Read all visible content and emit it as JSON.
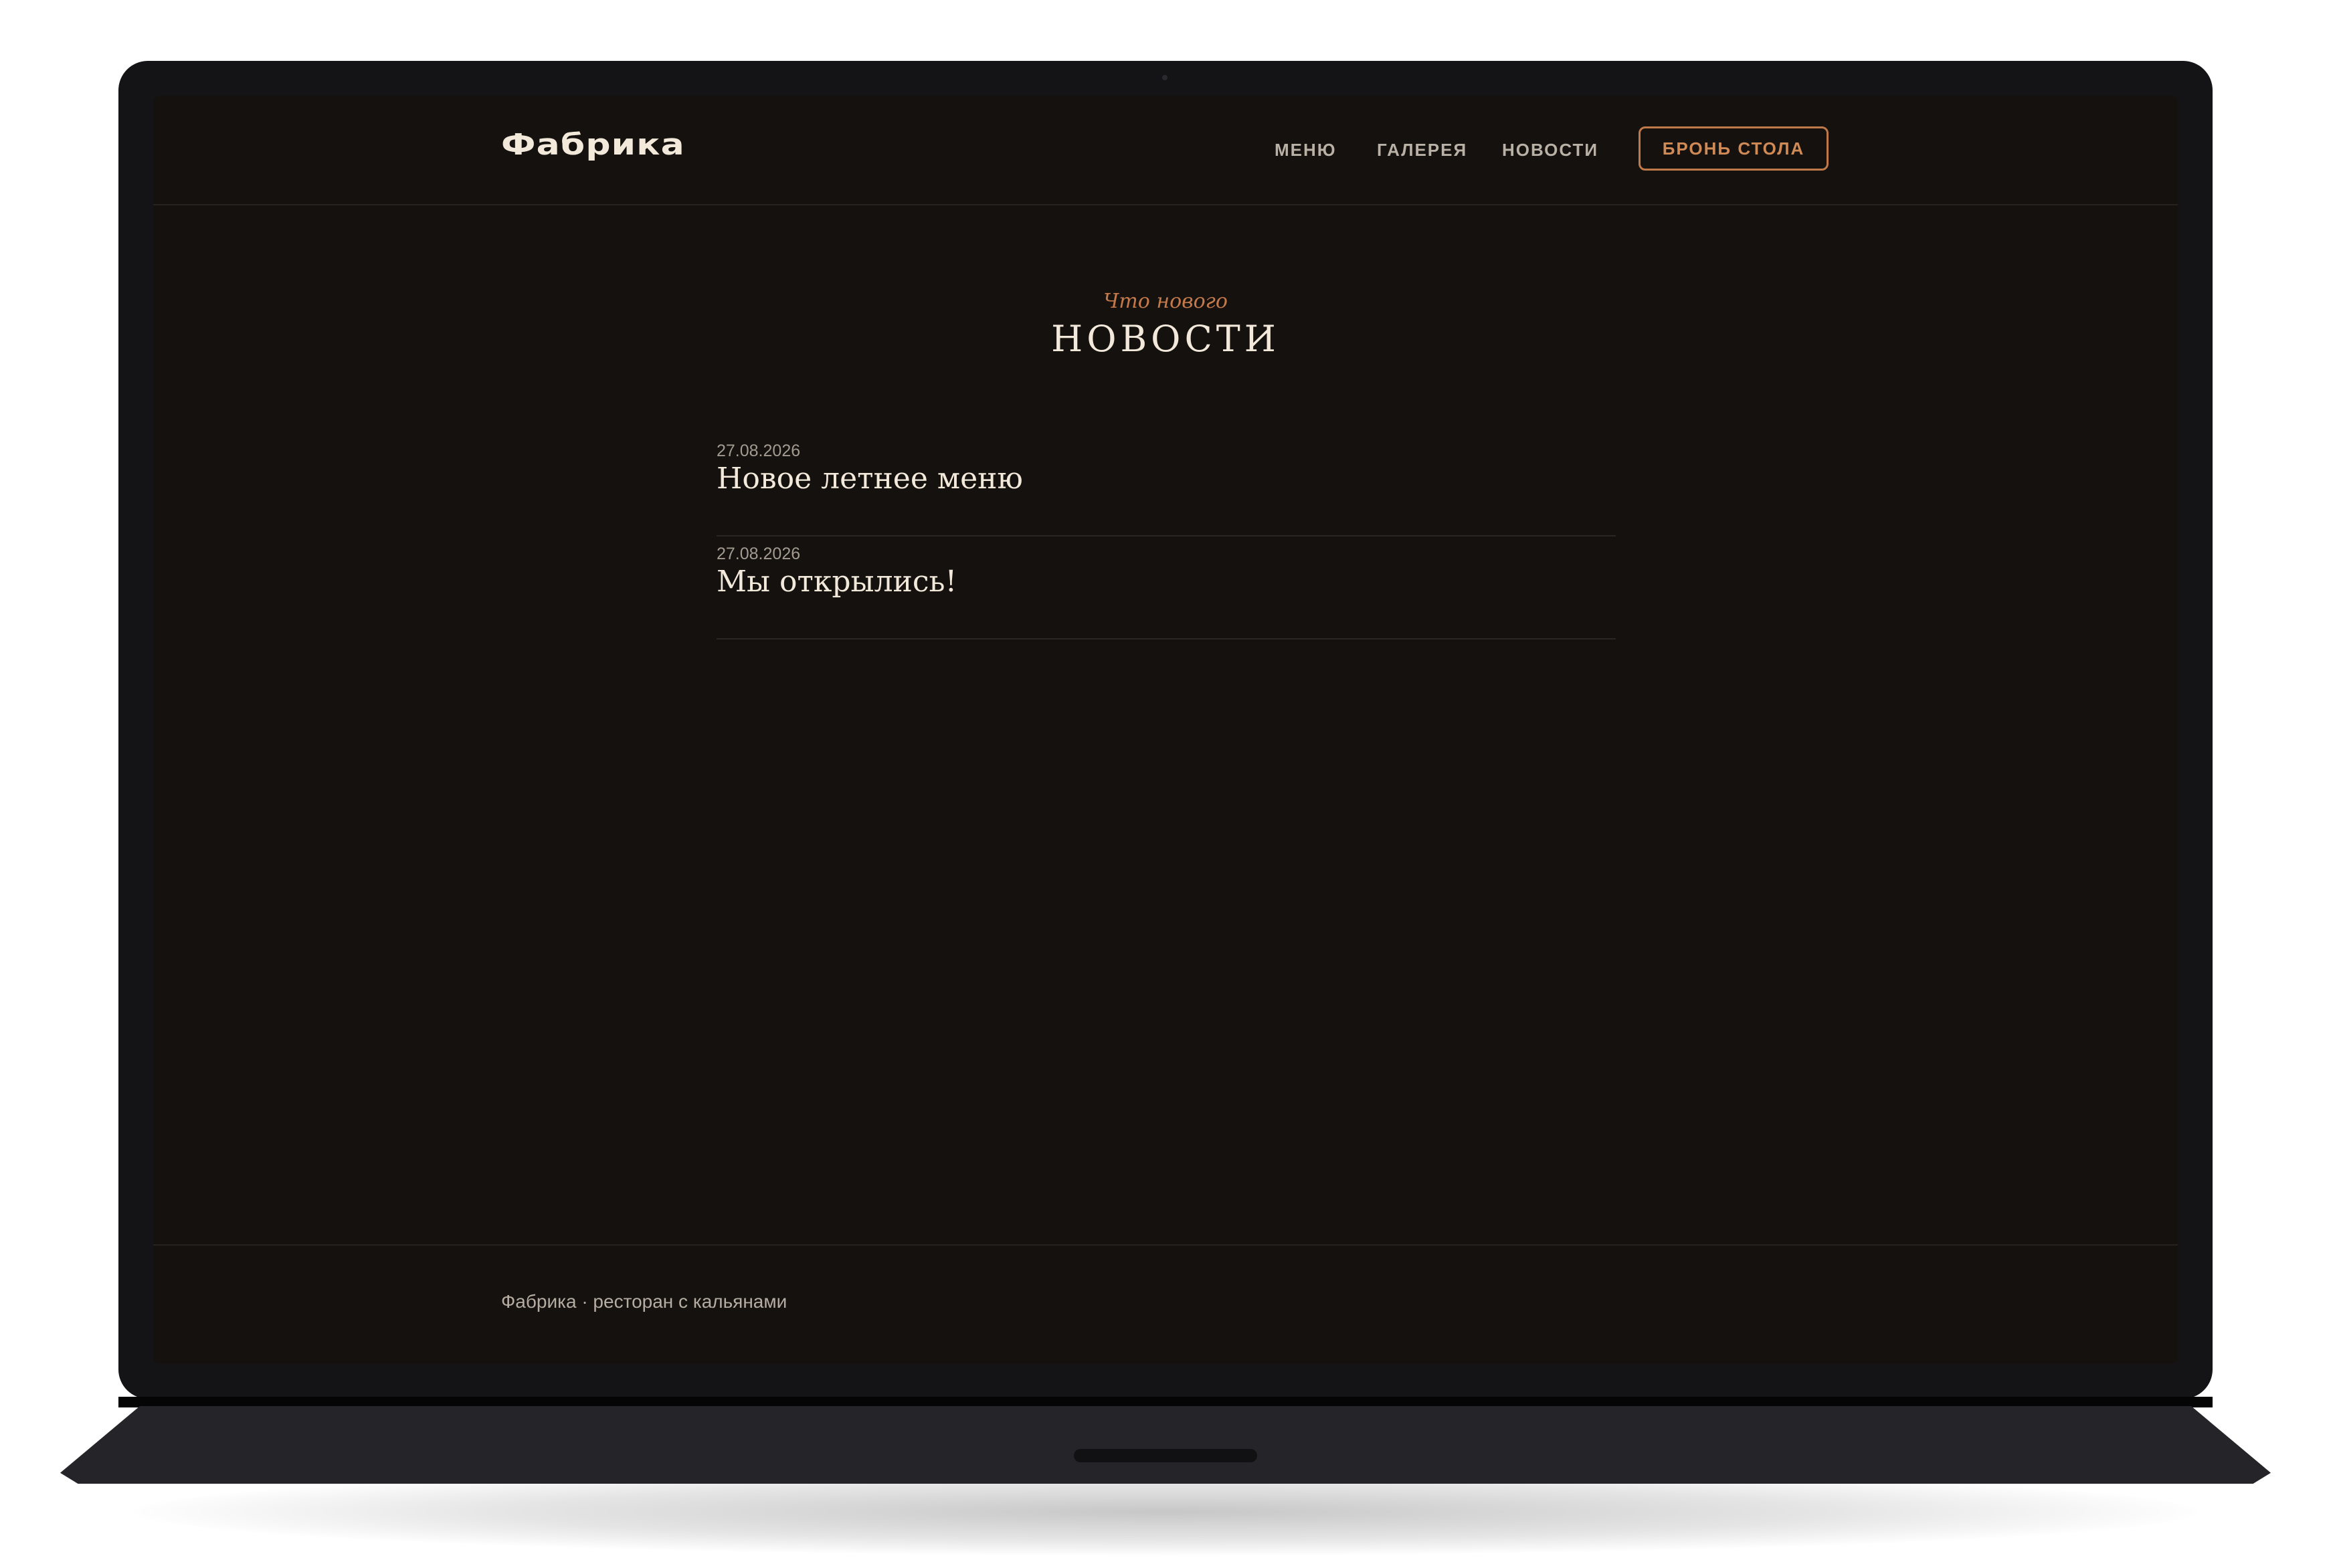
{
  "header": {
    "logo": "Фабрика",
    "nav": [
      {
        "label": "МЕНЮ"
      },
      {
        "label": "ГАЛЕРЕЯ"
      },
      {
        "label": "НОВОСТИ"
      }
    ],
    "book_button": "БРОНЬ СТОЛА"
  },
  "section": {
    "subtitle": "Что нового",
    "title": "НОВОСТИ"
  },
  "news": [
    {
      "date": "27.08.2026",
      "title": "Новое летнее меню"
    },
    {
      "date": "27.08.2026",
      "title": "Мы открылись!"
    }
  ],
  "footer": {
    "text": "Фабрика · ресторан с кальянами"
  },
  "colors": {
    "background": "#14110f",
    "accent": "#c4794a",
    "text_primary": "#f2e9db",
    "text_muted": "#b9b0a6"
  }
}
